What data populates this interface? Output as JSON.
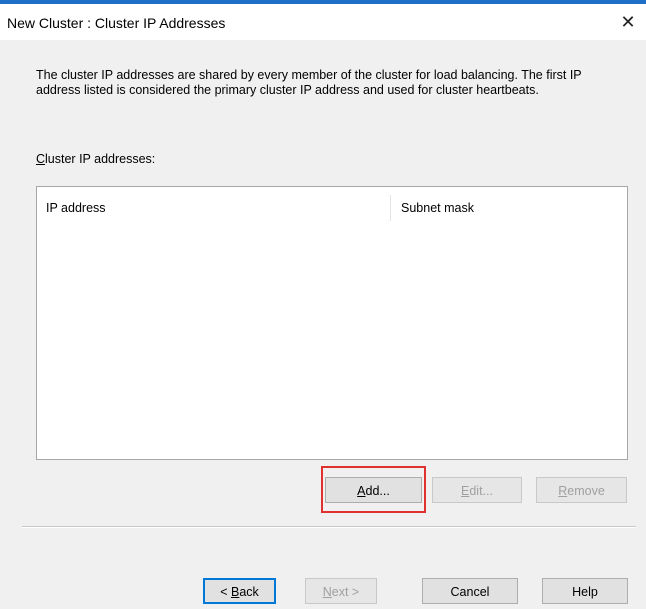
{
  "window": {
    "title": "New Cluster : Cluster IP Addresses",
    "close_glyph": "✕"
  },
  "description": "The cluster IP addresses are shared by every member of the cluster for load balancing. The first IP address listed is considered the primary cluster IP address and used for cluster heartbeats.",
  "list": {
    "label_first": "C",
    "label_rest": "luster IP addresses:",
    "columns": [
      "IP address",
      "Subnet mask"
    ],
    "rows": []
  },
  "list_buttons": {
    "add_first": "A",
    "add_rest": "dd...",
    "edit_first": "E",
    "edit_rest": "dit...",
    "remove_first": "R",
    "remove_rest": "emove"
  },
  "wizard_buttons": {
    "back_prefix": "< ",
    "back_first": "B",
    "back_rest": "ack",
    "next_first": "N",
    "next_rest": "ext >",
    "cancel": "Cancel",
    "help": "Help"
  },
  "colors": {
    "accent": "#1e6fc8",
    "highlight": "#e03030"
  }
}
